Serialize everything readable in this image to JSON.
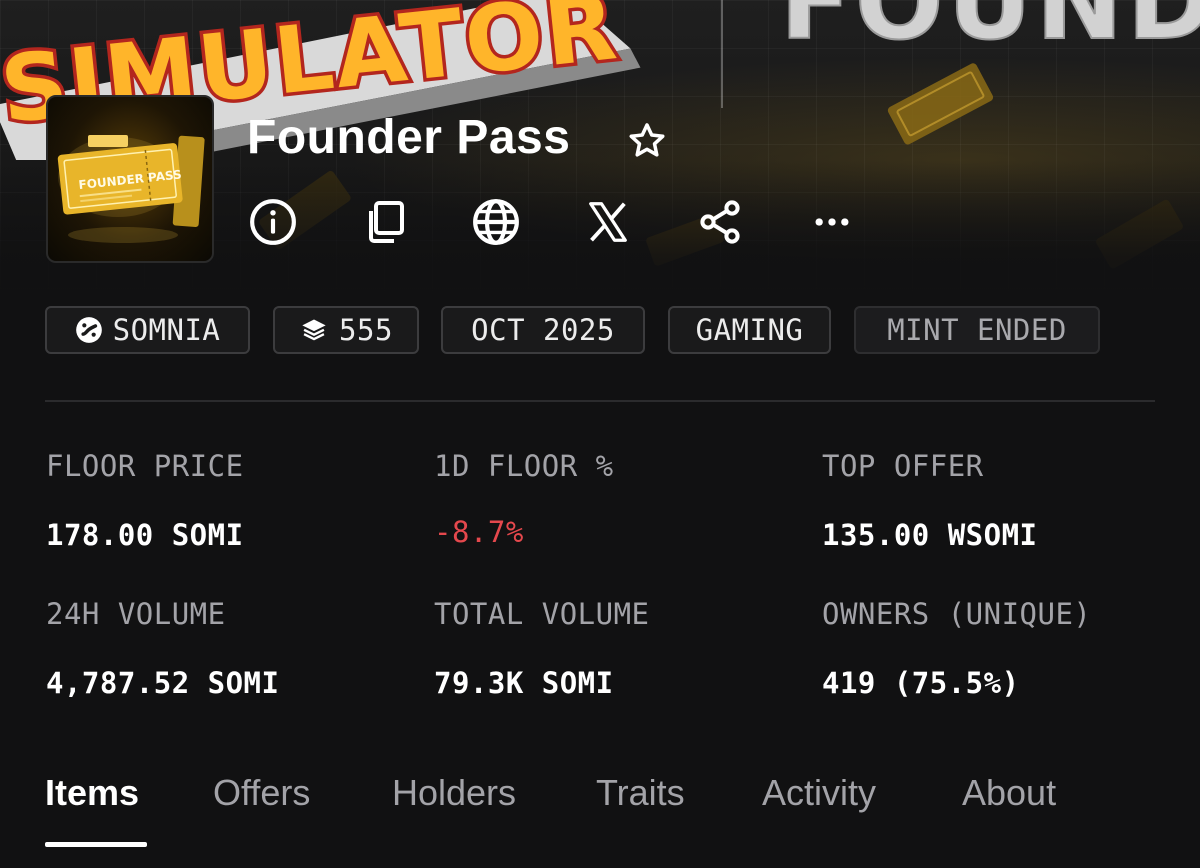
{
  "banner": {
    "left_art_text": "SIMULATOR",
    "right_art_text": "FOUNDER"
  },
  "collection": {
    "name": "Founder Pass",
    "avatar_text": "FOUNDER PASS"
  },
  "actions": [
    {
      "icon": "info-icon"
    },
    {
      "icon": "copy-icon"
    },
    {
      "icon": "globe-icon"
    },
    {
      "icon": "x-logo-icon"
    },
    {
      "icon": "share-icon"
    },
    {
      "icon": "more-icon"
    }
  ],
  "chips": {
    "chain": "SOMNIA",
    "supply": "555",
    "date": "OCT 2025",
    "category": "GAMING",
    "status": "MINT ENDED"
  },
  "stats": {
    "floor_price": {
      "label": "FLOOR PRICE",
      "value": "178.00 SOMI"
    },
    "floor_change_1d": {
      "label": "1D FLOOR %",
      "value": "-8.7%"
    },
    "top_offer": {
      "label": "TOP OFFER",
      "value": "135.00 WSOMI"
    },
    "volume_24h": {
      "label": "24H VOLUME",
      "value": "4,787.52 SOMI"
    },
    "total_volume": {
      "label": "TOTAL VOLUME",
      "value": "79.3K SOMI"
    },
    "owners": {
      "label": "OWNERS (UNIQUE)",
      "value": "419 (75.5%)"
    }
  },
  "tabs": [
    {
      "label": "Items",
      "active": true
    },
    {
      "label": "Offers",
      "active": false
    },
    {
      "label": "Holders",
      "active": false
    },
    {
      "label": "Traits",
      "active": false
    },
    {
      "label": "Activity",
      "active": false
    },
    {
      "label": "About",
      "active": false
    }
  ],
  "colors": {
    "background": "#111112",
    "negative": "#e5484d",
    "muted_text": "#a3a3a8",
    "gold": "#f2c230"
  }
}
